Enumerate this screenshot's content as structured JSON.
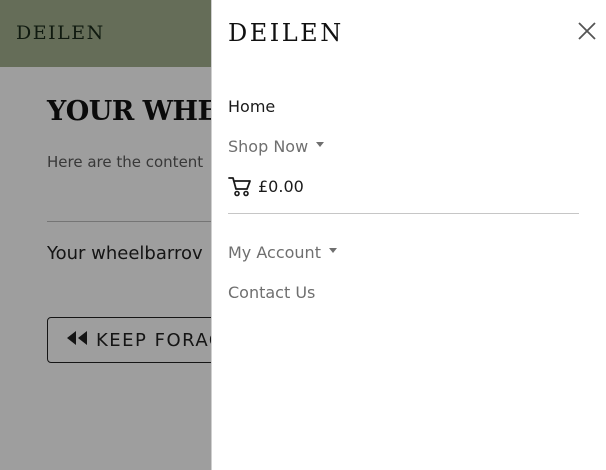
{
  "background": {
    "logo": "DEILEN",
    "title": "YOUR WHEE",
    "subtitle": "Here are the content",
    "message": "Your wheelbarrov",
    "button_label": "KEEP FORAG"
  },
  "offcanvas": {
    "logo": "DEILEN",
    "nav": {
      "home": "Home",
      "shop_now": "Shop Now",
      "cart_total": "£0.00",
      "my_account": "My Account",
      "contact_us": "Contact Us"
    }
  },
  "icons": {
    "close": "close-icon",
    "cart": "cart-icon",
    "rewind": "rewind-icon"
  },
  "colors": {
    "header_green": "#a3b18f",
    "text_dark": "#1a1a1a",
    "text_muted": "#6f6f6f"
  }
}
